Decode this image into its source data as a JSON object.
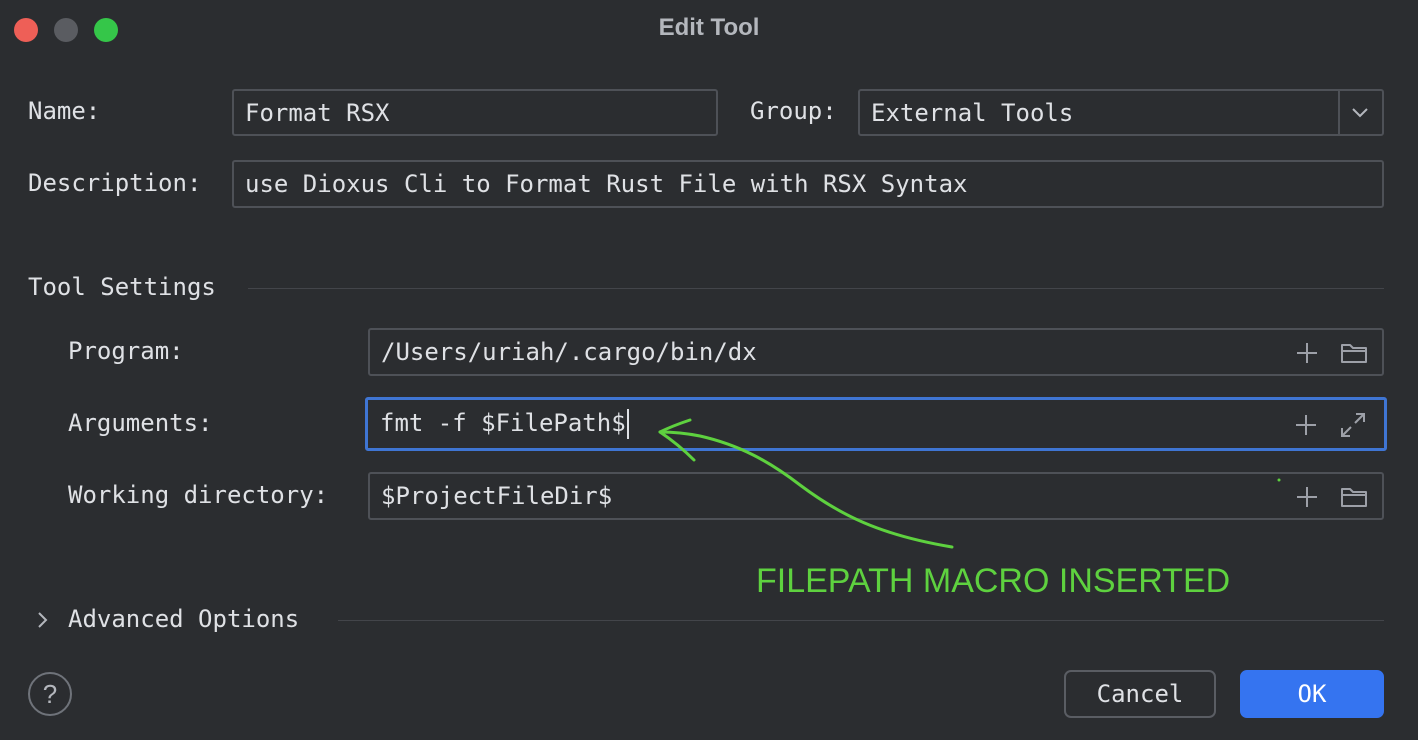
{
  "window": {
    "title": "Edit Tool"
  },
  "form": {
    "name_label": "Name:",
    "name_value": "Format RSX",
    "group_label": "Group:",
    "group_value": "External Tools",
    "description_label": "Description:",
    "description_value": "use Dioxus Cli to Format Rust File with RSX Syntax"
  },
  "tool_settings": {
    "section_title": "Tool Settings",
    "program_label": "Program:",
    "program_value": "/Users/uriah/.cargo/bin/dx",
    "arguments_label": "Arguments:",
    "arguments_value": "fmt -f $FilePath$",
    "working_dir_label": "Working directory:",
    "working_dir_value": "$ProjectFileDir$"
  },
  "advanced": {
    "label": "Advanced Options"
  },
  "footer": {
    "help_label": "?",
    "cancel_label": "Cancel",
    "ok_label": "OK"
  },
  "annotation": {
    "text": "FILEPATH MACRO INSERTED",
    "color": "#5ed13f"
  },
  "colors": {
    "accent": "#3574f0",
    "focus_border": "#3f75d3",
    "background": "#2b2d30"
  },
  "icons": {
    "add": "plus-icon",
    "folder": "folder-icon",
    "expand": "expand-icon",
    "dropdown": "chevron-down-icon",
    "disclosure": "chevron-right-icon"
  }
}
